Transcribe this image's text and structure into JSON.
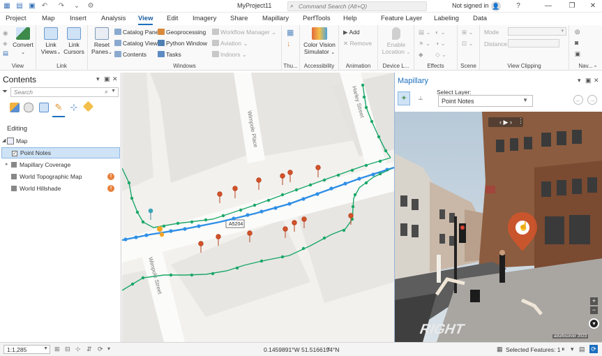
{
  "window": {
    "title": "MyProject11",
    "search_placeholder": "Command Search (Alt+Q)",
    "signin": "Not signed in",
    "help_glyph": "?",
    "min_glyph": "—",
    "restore_glyph": "❐",
    "close_glyph": "✕"
  },
  "tabs": [
    "Project",
    "Map",
    "Insert",
    "Analysis",
    "View",
    "Edit",
    "Imagery",
    "Share",
    "Mapillary",
    "PerfTools",
    "Help"
  ],
  "contextual_tabs": {
    "header": "Feature Layer",
    "items": [
      "Labeling",
      "Data"
    ]
  },
  "ribbon": {
    "groups": [
      "View",
      "Link",
      "Windows",
      "Thu...",
      "Accessibility",
      "Animation",
      "Device L...",
      "Effects",
      "Scene",
      "View Clipping",
      "Nav..."
    ],
    "convert": "Convert",
    "link_views": [
      "Link",
      "Views"
    ],
    "link_cursors": [
      "Link",
      "Cursors"
    ],
    "reset_panes": [
      "Reset",
      "Panes"
    ],
    "catalog_pane": "Catalog Pane",
    "catalog_view": "Catalog View",
    "contents": "Contents",
    "geoprocessing": "Geoprocessing",
    "python_window": "Python Window",
    "tasks": "Tasks",
    "workflow_manager": "Workflow Manager",
    "aviation": "Aviation",
    "indoors": "Indoors",
    "color_vision": [
      "Color Vision",
      "Simulator"
    ],
    "add": "Add",
    "remove": "Remove",
    "enable_location": [
      "Enable",
      "Location"
    ],
    "mode_label": "Mode",
    "distance_label": "Distance"
  },
  "contents_pane": {
    "title": "Contents",
    "search_placeholder": "Search",
    "section": "Editing",
    "map_label": "Map",
    "layers": [
      {
        "name": "Point Notes",
        "checked": true,
        "selected": true,
        "warning": false
      },
      {
        "name": "Mapillary Coverage",
        "checked": false,
        "selected": false,
        "warning": false
      },
      {
        "name": "World Topographic Map",
        "checked": false,
        "selected": false,
        "warning": true
      },
      {
        "name": "World Hillshade",
        "checked": false,
        "selected": false,
        "warning": true
      }
    ]
  },
  "map": {
    "road_label": "A5204",
    "street_names": [
      "Wimpole Place",
      "Harley Street",
      "Wimpole Street"
    ]
  },
  "mapillary": {
    "title": "Mapillary",
    "select_layer_label": "Select Layer:",
    "selected_layer": "Point Notes",
    "photo_credit": "adurbsurver 2023",
    "road_marking": "RIGHT"
  },
  "status": {
    "scale": "1:1,285",
    "coordinates": "0.1459891°W 51.5166194°N",
    "selected_features": "Selected Features: 1"
  },
  "colors": {
    "accent": "#1b6fbf",
    "traffic_green": "#1aa768",
    "traffic_blue": "#2f8fe6",
    "pin": "#d4532a"
  }
}
